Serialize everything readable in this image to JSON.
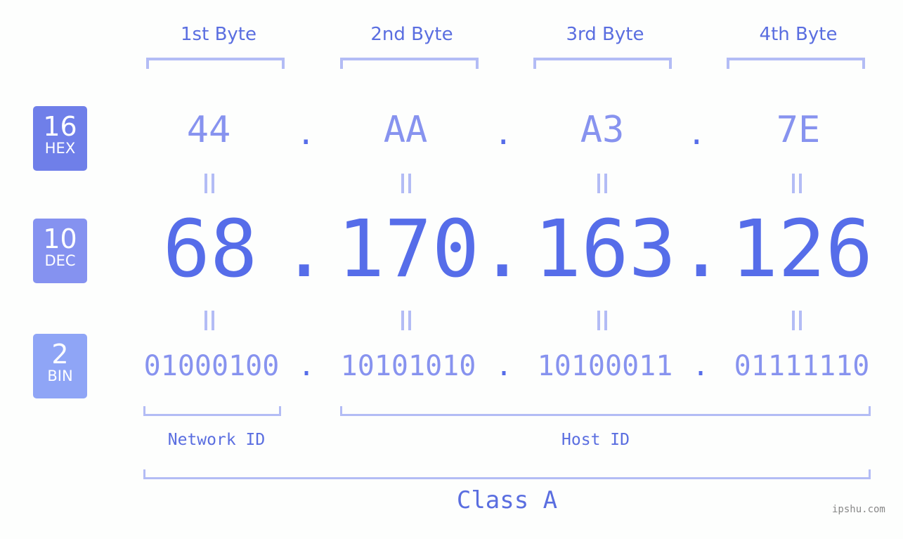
{
  "headers": [
    "1st Byte",
    "2nd Byte",
    "3rd Byte",
    "4th Byte"
  ],
  "badges": {
    "hex": {
      "num": "16",
      "label": "HEX",
      "color": "#6f7fe9"
    },
    "dec": {
      "num": "10",
      "label": "DEC",
      "color": "#8592f0"
    },
    "bin": {
      "num": "2",
      "label": "BIN",
      "color": "#8fa5f6"
    }
  },
  "hex": [
    "44",
    "AA",
    "A3",
    "7E"
  ],
  "dec": [
    "68",
    "170",
    "163",
    "126"
  ],
  "bin": [
    "01000100",
    "10101010",
    "10100011",
    "01111110"
  ],
  "separator": ".",
  "labels": {
    "network": "Network ID",
    "host": "Host ID",
    "class": "Class A"
  },
  "watermark": "ipshu.com",
  "colors": {
    "accent": "#566de9",
    "light": "#8793ef",
    "bracket": "#b3bcf5"
  }
}
